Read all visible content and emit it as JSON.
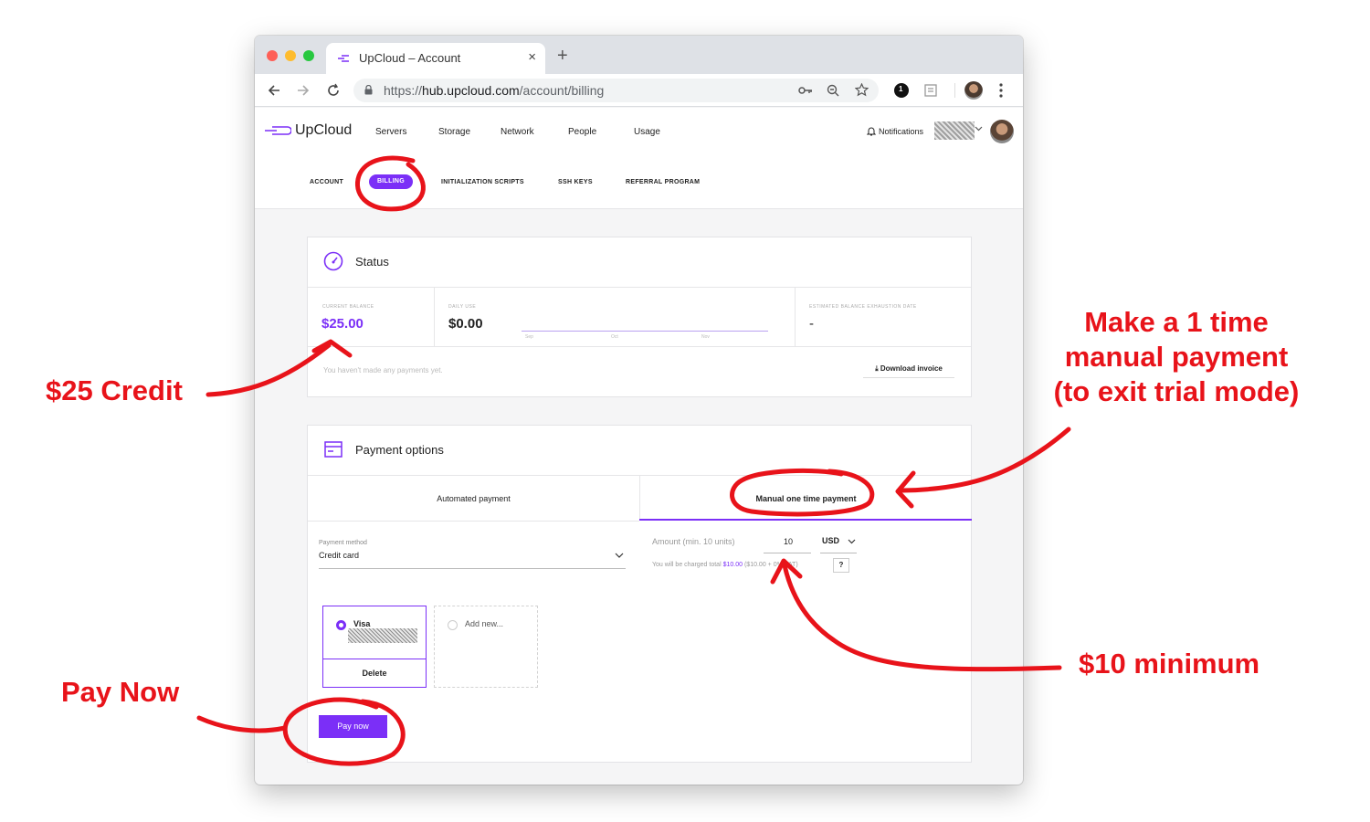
{
  "browser": {
    "tab_title": "UpCloud – Account",
    "tab_close": "×",
    "new_tab": "+",
    "url_scheme": "https://",
    "url_host": "hub.upcloud.com",
    "url_path": "/account/billing",
    "ext_badge": "1"
  },
  "app": {
    "logo": "UpCloud",
    "nav": [
      "Servers",
      "Storage",
      "Network",
      "People",
      "Usage"
    ],
    "notifications": "Notifications",
    "subnav": [
      "ACCOUNT",
      "BILLING",
      "INITIALIZATION SCRIPTS",
      "SSH KEYS",
      "REFERRAL PROGRAM"
    ],
    "brand_color": "#7b2ff7"
  },
  "status": {
    "title": "Status",
    "current_balance_label": "CURRENT BALANCE",
    "current_balance": "$25.00",
    "daily_use_label": "DAILY USE",
    "daily_use": "$0.00",
    "chart_months": [
      "Sep",
      "Oct",
      "Nov"
    ],
    "exhaustion_label": "ESTIMATED BALANCE EXHAUSTION DATE",
    "exhaustion_value": "-",
    "no_payments": "You haven't made any payments yet.",
    "download_invoice": "Download invoice"
  },
  "payment": {
    "title": "Payment options",
    "tab_automated": "Automated payment",
    "tab_manual": "Manual one time payment",
    "method_label": "Payment method",
    "method_value": "Credit card",
    "amount_label": "Amount (min. 10 units)",
    "amount_value": "10",
    "currency": "USD",
    "charge_prefix": "You will be charged total",
    "charge_total": "$10.00",
    "charge_suffix": "($10.00 + 0% VAT)",
    "help_button": "?",
    "card_name": "Visa",
    "delete_label": "Delete",
    "add_new": "Add new...",
    "pay_now": "Pay now"
  },
  "annotations": {
    "credit": "$25 Credit",
    "manual_line1": "Make a 1 time",
    "manual_line2": "manual payment",
    "manual_line3": "(to exit trial mode)",
    "minimum": "$10 minimum",
    "pay_now": "Pay Now",
    "color": "#e8131a"
  }
}
